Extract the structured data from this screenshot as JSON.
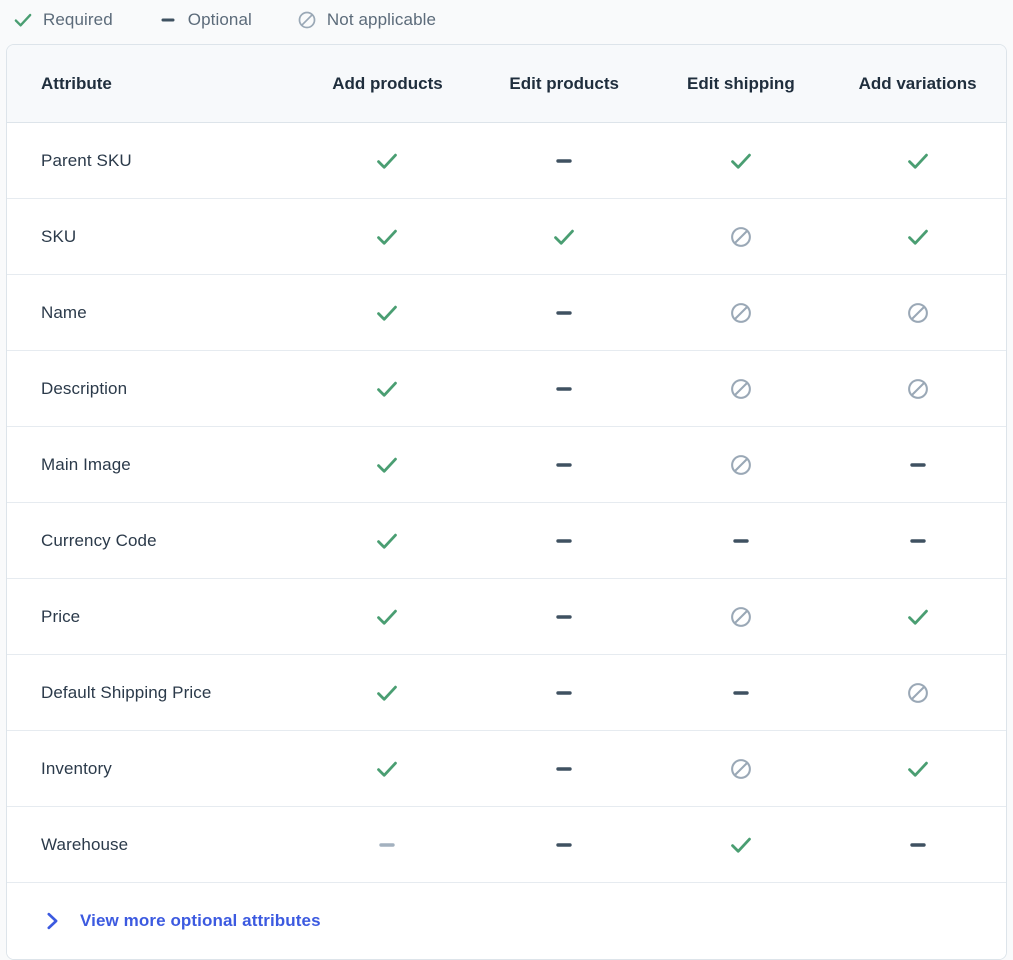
{
  "legend": {
    "items": [
      {
        "icon": "check-icon",
        "label": "Required"
      },
      {
        "icon": "dash-icon",
        "label": "Optional"
      },
      {
        "icon": "not-applicable-icon",
        "label": "Not applicable"
      }
    ]
  },
  "table": {
    "columns": [
      "Attribute",
      "Add products",
      "Edit products",
      "Edit shipping",
      "Add variations"
    ],
    "rows": [
      {
        "attribute": "Parent SKU",
        "values": [
          "required",
          "optional",
          "required",
          "required"
        ]
      },
      {
        "attribute": "SKU",
        "values": [
          "required",
          "required",
          "not-applicable",
          "required"
        ]
      },
      {
        "attribute": "Name",
        "values": [
          "required",
          "optional",
          "not-applicable",
          "not-applicable"
        ]
      },
      {
        "attribute": "Description",
        "values": [
          "required",
          "optional",
          "not-applicable",
          "not-applicable"
        ]
      },
      {
        "attribute": "Main Image",
        "values": [
          "required",
          "optional",
          "not-applicable",
          "optional"
        ]
      },
      {
        "attribute": "Currency Code",
        "values": [
          "required",
          "optional",
          "optional",
          "optional"
        ]
      },
      {
        "attribute": "Price",
        "values": [
          "required",
          "optional",
          "not-applicable",
          "required"
        ]
      },
      {
        "attribute": "Default Shipping Price",
        "values": [
          "required",
          "optional",
          "optional",
          "not-applicable"
        ]
      },
      {
        "attribute": "Inventory",
        "values": [
          "required",
          "optional",
          "not-applicable",
          "required"
        ]
      },
      {
        "attribute": "Warehouse",
        "values": [
          "optional-muted",
          "optional",
          "required",
          "optional"
        ]
      }
    ]
  },
  "footer": {
    "expand_icon": "chevron-right-icon",
    "expand_label": "View more optional attributes"
  },
  "colors": {
    "required_green": "#4a9e72",
    "optional_slate": "#3f5161",
    "optional_muted": "#a3b1bf",
    "not_applicable_gray": "#9aa8b6",
    "link_blue": "#3c5ae0",
    "header_text": "#1f2e3d",
    "row_text": "#2b3a4a",
    "legend_text": "#5c6b7a",
    "border": "#dde4ea",
    "row_border": "#e6ebf0",
    "header_bg": "#f7f9fb",
    "page_bg": "#f9fafb",
    "card_bg": "#ffffff"
  }
}
